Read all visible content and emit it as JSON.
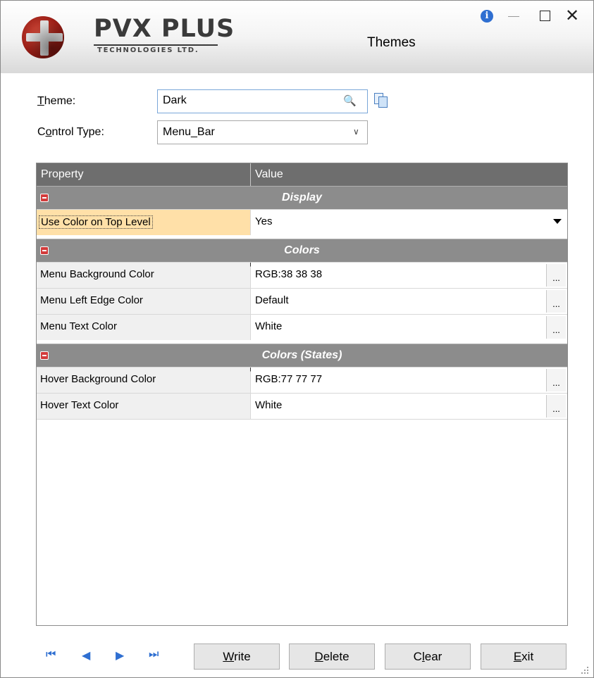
{
  "window": {
    "title": "Themes",
    "logo_title": "PVX PLUS",
    "logo_subtitle": "TECHNOLOGIES LTD.",
    "controls": {
      "info": "i",
      "minimize": "—",
      "maximize": "□",
      "close": "✕"
    }
  },
  "form": {
    "theme_label_mn": "T",
    "theme_label_rest": "heme:",
    "theme_value": "Dark",
    "control_type_label_pre": "C",
    "control_type_label_mn": "o",
    "control_type_label_rest": "ntrol Type:",
    "control_type_value": "Menu_Bar"
  },
  "grid": {
    "headers": {
      "property": "Property",
      "value": "Value"
    },
    "sections": [
      {
        "title": "Display",
        "rows": [
          {
            "property": "Use Color on Top Level",
            "value": "Yes"
          }
        ]
      },
      {
        "title": "Colors",
        "rows": [
          {
            "property": "Menu Background Color",
            "value": "RGB:38 38 38"
          },
          {
            "property": "Menu Left Edge Color",
            "value": "Default"
          },
          {
            "property": "Menu Text Color",
            "value": "White"
          }
        ]
      },
      {
        "title": "Colors (States)",
        "rows": [
          {
            "property": "Hover Background Color",
            "value": "RGB:77 77 77"
          },
          {
            "property": "Hover Text Color",
            "value": "White"
          }
        ]
      }
    ],
    "ellipsis": "..."
  },
  "footer": {
    "nav": {
      "first": "⏮",
      "prev": "◀",
      "next": "▶",
      "last": "⏭"
    },
    "write_mn": "W",
    "write_rest": "rite",
    "delete_mn": "D",
    "delete_rest": "elete",
    "clear_pre": "C",
    "clear_mn": "l",
    "clear_rest": "ear",
    "exit_mn": "E",
    "exit_rest": "xit"
  },
  "colors": {
    "accent": "#2f6fd1",
    "grid_header": "#6e6e6e",
    "section": "#8c8c8c",
    "selected_row": "#ffe0a8"
  }
}
